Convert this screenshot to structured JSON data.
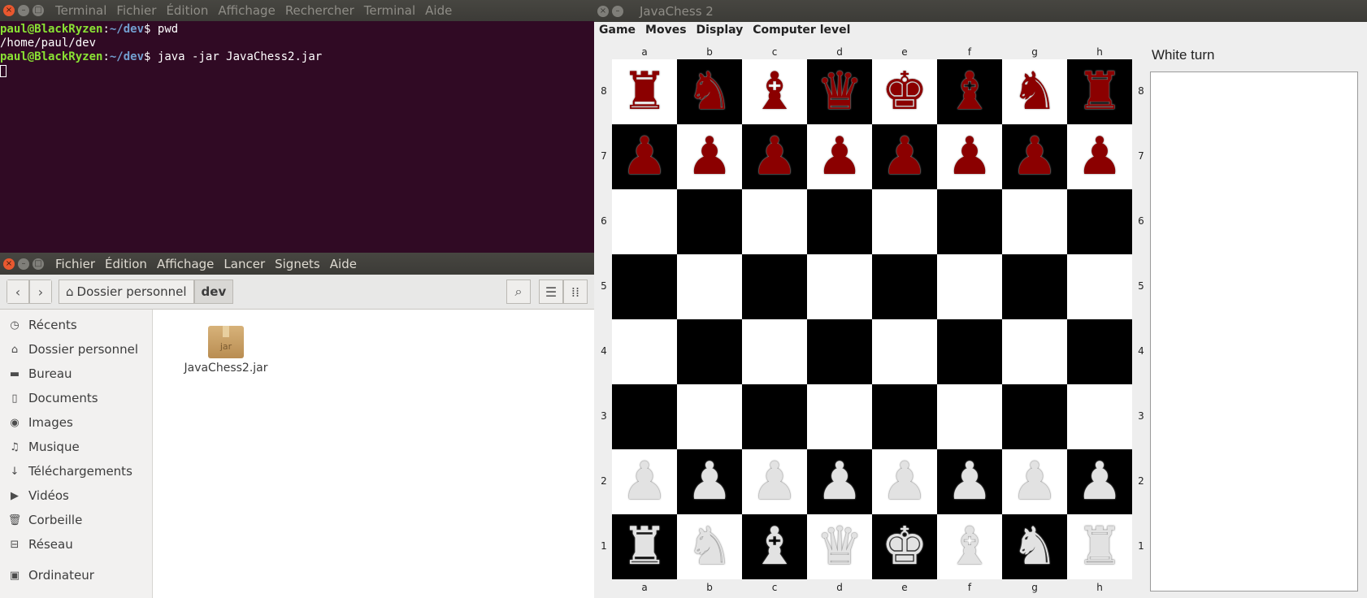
{
  "terminal": {
    "menu": [
      "Terminal",
      "Fichier",
      "Édition",
      "Affichage",
      "Rechercher",
      "Terminal",
      "Aide"
    ],
    "lines": [
      {
        "user": "paul@BlackRyzen",
        "path": "~/dev",
        "command": " pwd"
      },
      {
        "output": "/home/paul/dev"
      },
      {
        "user": "paul@BlackRyzen",
        "path": "~/dev",
        "command": " java -jar JavaChess2.jar"
      }
    ]
  },
  "filemanager": {
    "menu": [
      "Fichier",
      "Édition",
      "Affichage",
      "Lancer",
      "Signets",
      "Aide"
    ],
    "breadcrumb": {
      "home": "Dossier personnel",
      "current": "dev"
    },
    "sidebar": [
      {
        "label": "Récents",
        "icon": "clock-icon"
      },
      {
        "label": "Dossier personnel",
        "icon": "home-icon"
      },
      {
        "label": "Bureau",
        "icon": "folder-icon"
      },
      {
        "label": "Documents",
        "icon": "document-icon"
      },
      {
        "label": "Images",
        "icon": "camera-icon"
      },
      {
        "label": "Musique",
        "icon": "music-icon"
      },
      {
        "label": "Téléchargements",
        "icon": "download-icon"
      },
      {
        "label": "Vidéos",
        "icon": "video-icon"
      },
      {
        "label": "Corbeille",
        "icon": "trash-icon"
      },
      {
        "label": "Réseau",
        "icon": "network-icon"
      },
      {
        "label": "Ordinateur",
        "icon": "computer-icon"
      }
    ],
    "files": [
      {
        "name": "JavaChess2.jar",
        "icon_text": "jar"
      }
    ]
  },
  "chess": {
    "title": "JavaChess 2",
    "menu": [
      "Game",
      "Moves",
      "Display",
      "Computer level"
    ],
    "turn": "White turn",
    "files": [
      "a",
      "b",
      "c",
      "d",
      "e",
      "f",
      "g",
      "h"
    ],
    "ranks": [
      "8",
      "7",
      "6",
      "5",
      "4",
      "3",
      "2",
      "1"
    ],
    "board": [
      [
        "br",
        "bn",
        "bb",
        "bq",
        "bk",
        "bb",
        "bn",
        "br"
      ],
      [
        "bp",
        "bp",
        "bp",
        "bp",
        "bp",
        "bp",
        "bp",
        "bp"
      ],
      [
        "",
        "",
        "",
        "",
        "",
        "",
        "",
        ""
      ],
      [
        "",
        "",
        "",
        "",
        "",
        "",
        "",
        ""
      ],
      [
        "",
        "",
        "",
        "",
        "",
        "",
        "",
        ""
      ],
      [
        "",
        "",
        "",
        "",
        "",
        "",
        "",
        ""
      ],
      [
        "wp",
        "wp",
        "wp",
        "wp",
        "wp",
        "wp",
        "wp",
        "wp"
      ],
      [
        "wr",
        "wn",
        "wb",
        "wq",
        "wk",
        "wb",
        "wn",
        "wr"
      ]
    ],
    "colors": {
      "dark_piece": "#8b0000",
      "light_piece": "#e2e2e2",
      "dark_square": "#000000",
      "light_square": "#ffffff"
    }
  }
}
